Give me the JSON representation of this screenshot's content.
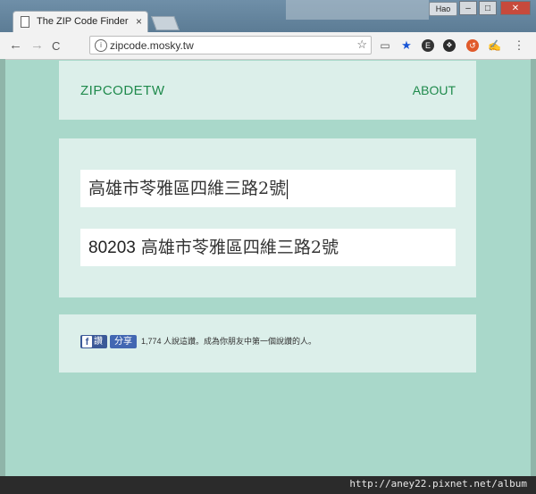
{
  "browser": {
    "tab_title": "The ZIP Code Finder fo",
    "tab_close": "×",
    "profile_label": "Hao",
    "url": "zipcode.mosky.tw",
    "window_buttons": {
      "minimize": "–",
      "maximize": "□",
      "close": "✕"
    },
    "nav": {
      "back": "←",
      "forward": "→",
      "reload": "C"
    }
  },
  "site": {
    "brand": "ZIPCODETW",
    "about": "ABOUT"
  },
  "form": {
    "address_value": "高雄市苓雅區四維三路2號",
    "result_zip": "80203",
    "result_address": "高雄市苓雅區四維三路2號"
  },
  "social": {
    "like_label": "讚",
    "share_label": "分享",
    "like_text": "1,774 人說這讚。成為你朋友中第一個說讚的人。"
  },
  "watermark": "http://aney22.pixnet.net/album",
  "colors": {
    "background": "#a9d8ca",
    "card": "#dcefea",
    "brand_green": "#1f8a4c",
    "facebook": "#3b5998"
  },
  "icons": [
    "page-icon",
    "info-icon",
    "bookmark-star-icon",
    "cast-icon",
    "extension-star-icon",
    "extension-icon",
    "evernote-icon",
    "extension-badge-icon",
    "signature-icon",
    "menu-icon"
  ]
}
